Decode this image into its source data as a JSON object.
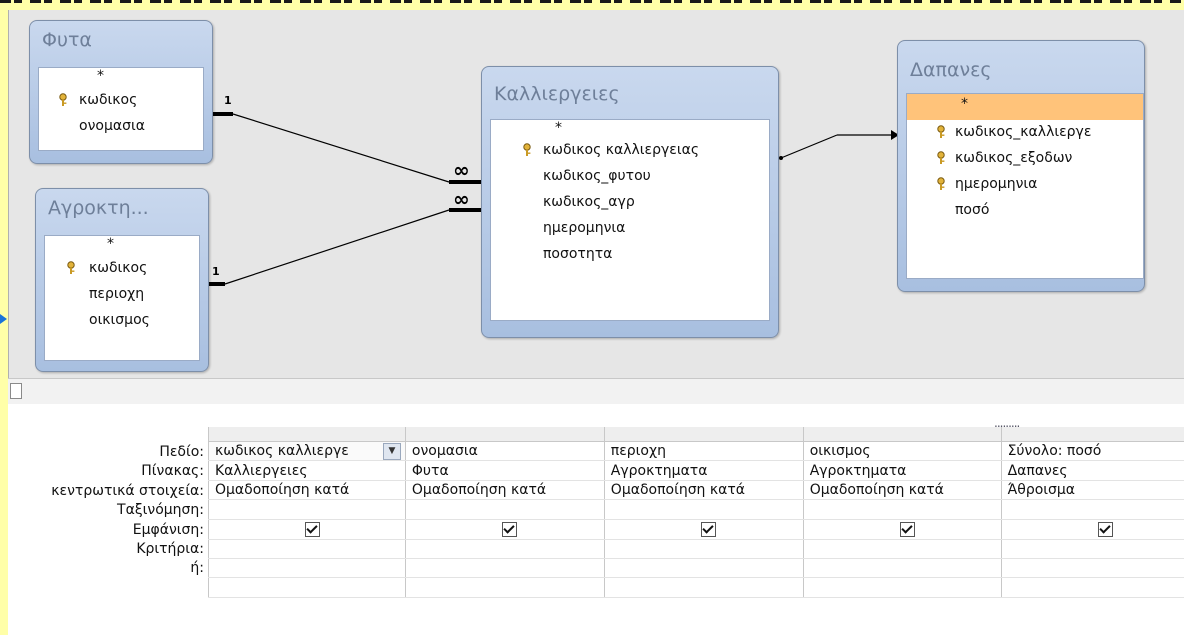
{
  "tables": {
    "futa": {
      "title": "Φυτα",
      "fields": [
        "*",
        "κωδικος",
        "ονομασια"
      ]
    },
    "agroktimata": {
      "title": "Αγροκτη...",
      "fields": [
        "*",
        "κωδικος",
        "περιοχη",
        "οικισμος"
      ]
    },
    "kalliergeies": {
      "title": "Καλλιεργειες",
      "fields": [
        "*",
        "κωδικος καλλιεργειας",
        "κωδικος_φυτου",
        "κωδικος_αγρ",
        "ημερομηνια",
        "ποσοτητα"
      ]
    },
    "dapanes": {
      "title": "Δαπανες",
      "fields": [
        "*",
        "κωδικος_καλλιεργε",
        "κωδικος_εξοδων",
        "ημερομηνια",
        "ποσό"
      ]
    }
  },
  "relationships": {
    "one": "1",
    "many": "∞"
  },
  "grid": {
    "row_labels": [
      "Πεδίο:",
      "Πίνακας:",
      "κεντρωτικά στοιχεία:",
      "Ταξινόμηση:",
      "Εμφάνιση:",
      "Κριτήρια:",
      "ή:"
    ],
    "columns": [
      {
        "field": "κωδικος καλλιεργε",
        "table": "Καλλιεργειες",
        "total": "Ομαδοποίηση κατά",
        "show": true
      },
      {
        "field": "ονομασια",
        "table": "Φυτα",
        "total": "Ομαδοποίηση κατά",
        "show": true
      },
      {
        "field": "περιοχη",
        "table": "Αγροκτηματα",
        "total": "Ομαδοποίηση κατά",
        "show": true
      },
      {
        "field": "οικισμος",
        "table": "Αγροκτηματα",
        "total": "Ομαδοποίηση κατά",
        "show": true
      },
      {
        "field": "Σύνολο: ποσό",
        "table": "Δαπανες",
        "total": "Άθροισμα",
        "show": true
      }
    ],
    "grip": "........."
  },
  "colors": {
    "background": "#ffffa8",
    "selected_field": "#ffc37a",
    "table_header": "#b4c8e6"
  }
}
